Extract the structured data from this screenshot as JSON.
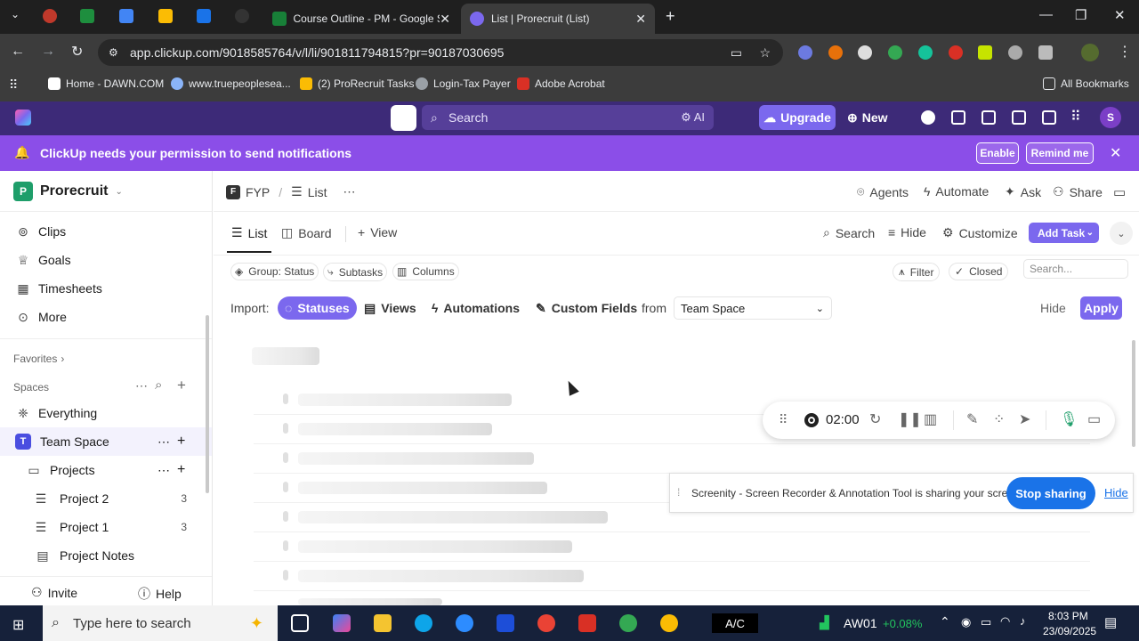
{
  "browser": {
    "tabs": [
      {
        "title": "Course Outline - PM - Google S",
        "color": "#188038"
      },
      {
        "title": "List | Prorecruit (List)",
        "color": "#7b68ee"
      }
    ],
    "url": "app.clickup.com/9018585764/v/l/li/901811794815?pr=90187030695",
    "bookmarks": [
      "Home - DAWN.COM",
      "www.truepeoplesea...",
      "(2) ProRecruit Tasks",
      "Login-Tax Payer",
      "Adobe Acrobat"
    ],
    "all_bookmarks": "All Bookmarks"
  },
  "clickup_top": {
    "search_placeholder": "Search",
    "ai_label": "AI",
    "upgrade_label": "Upgrade",
    "new_label": "New",
    "avatar_initial": "S"
  },
  "notification": {
    "message": "ClickUp needs your permission to send notifications",
    "enable": "Enable",
    "remind": "Remind me"
  },
  "sidebar": {
    "workspace_initial": "P",
    "workspace_name": "Prorecruit",
    "items": [
      {
        "label": "Clips",
        "icon": "clips-icon"
      },
      {
        "label": "Goals",
        "icon": "goals-icon"
      },
      {
        "label": "Timesheets",
        "icon": "timesheets-icon"
      },
      {
        "label": "More",
        "icon": "more-icon"
      }
    ],
    "favorites": "Favorites",
    "spaces": "Spaces",
    "everything": "Everything",
    "team_space_initial": "T",
    "team_space": "Team Space",
    "projects_folder": "Projects",
    "lists": [
      {
        "label": "Project 2",
        "count": "3"
      },
      {
        "label": "Project 1",
        "count": "3"
      }
    ],
    "project_notes": "Project Notes",
    "invite": "Invite",
    "help": "Help"
  },
  "main": {
    "breadcrumb": {
      "space_initial": "F",
      "space": "FYP",
      "sep": "/",
      "list": "List"
    },
    "header_actions": [
      "Agents",
      "Automate",
      "Ask",
      "Share"
    ],
    "view_tabs": [
      "List",
      "Board",
      "View"
    ],
    "view_tools": [
      "Search",
      "Hide",
      "Customize"
    ],
    "add_task": "Add Task",
    "toolbar": [
      "Group: Status",
      "Subtasks",
      "Columns"
    ],
    "filter": "Filter",
    "closed": "Closed",
    "search_placeholder": "Search...",
    "import": {
      "label": "Import:",
      "options": [
        "Statuses",
        "Views",
        "Automations",
        "Custom Fields"
      ],
      "from": "from",
      "source": "Team Space",
      "hide": "Hide",
      "apply": "Apply"
    }
  },
  "recorder": {
    "timer": "02:00"
  },
  "sharing": {
    "message": "Screenity - Screen Recorder & Annotation Tool is sharing your screen.",
    "stop": "Stop sharing",
    "hide": "Hide"
  },
  "taskbar": {
    "search_placeholder": "Type here to search",
    "ac_label": "A/C",
    "stock_label": "AW01",
    "stock_change": "+0.08%",
    "time": "8:03 PM",
    "date": "23/09/2025"
  },
  "colors": {
    "purple": "#7b68ee",
    "notif": "#8b4ee8",
    "stop_blue": "#1a73e8"
  }
}
